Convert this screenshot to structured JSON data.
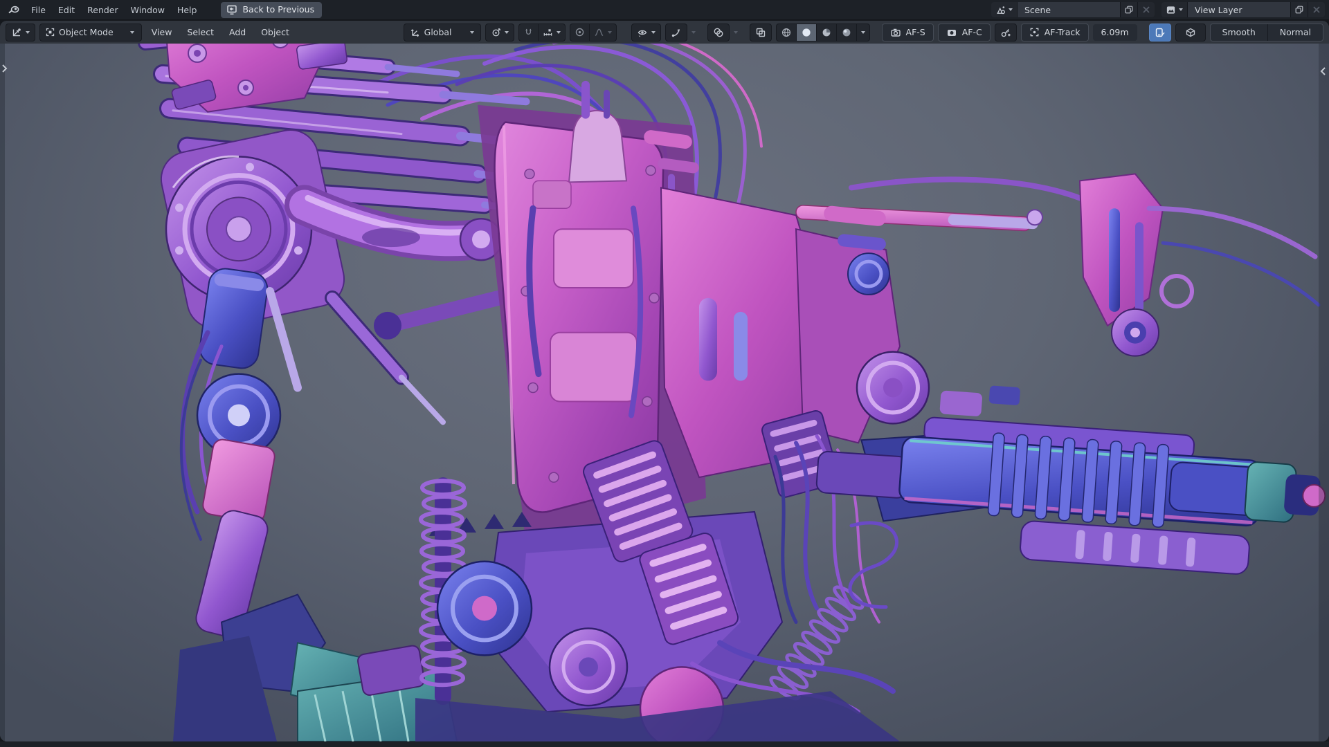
{
  "topbar": {
    "menus": [
      "File",
      "Edit",
      "Render",
      "Window",
      "Help"
    ],
    "back_button_label": "Back to Previous",
    "scene_value": "Scene",
    "view_layer_value": "View Layer"
  },
  "viewport_header": {
    "mode_label": "Object Mode",
    "menus": [
      "View",
      "Select",
      "Add",
      "Object"
    ],
    "orientation_label": "Global",
    "af_s_label": "AF-S",
    "af_c_label": "AF-C",
    "af_track_label": "AF-Track",
    "focus_distance": "6.09m",
    "shade_smooth_label": "Smooth",
    "shade_normal_label": "Normal"
  },
  "viewport": {
    "content": "mech-robot-3d-model-matcap-normal-shading"
  },
  "colors": {
    "topbar_bg": "#1d2127",
    "header_bg": "#30353d",
    "accent_blue": "#4c79b8",
    "viewport_bg_center": "#6b7180",
    "viewport_bg_edge": "#464d5b",
    "model_purple": "#9a5fd0",
    "model_magenta": "#c75fc8",
    "model_blue": "#4a50c4",
    "model_pink": "#cf6ac9",
    "model_teal": "#3b7f8c"
  },
  "icons": [
    "blender-logo-icon",
    "back-screen-icon",
    "scene-icon",
    "view-layer-icon",
    "duplicate-icon",
    "close-icon",
    "editor-type-icon",
    "object-mode-icon",
    "orientation-icon",
    "pivot-icon",
    "magnet-icon",
    "snap-target-icon",
    "proportional-icon",
    "falloff-icon",
    "visibility-eye-icon",
    "gizmo-icon",
    "overlays-icon",
    "xray-icon",
    "wireframe-icon",
    "solid-icon",
    "material-icon",
    "rendered-icon",
    "camera-icon",
    "camera-filled-icon",
    "key-add-icon",
    "track-icon",
    "screen-pen-icon",
    "cube-icon",
    "chevron-down-icon",
    "chevron-left-icon",
    "chevron-right-icon"
  ]
}
